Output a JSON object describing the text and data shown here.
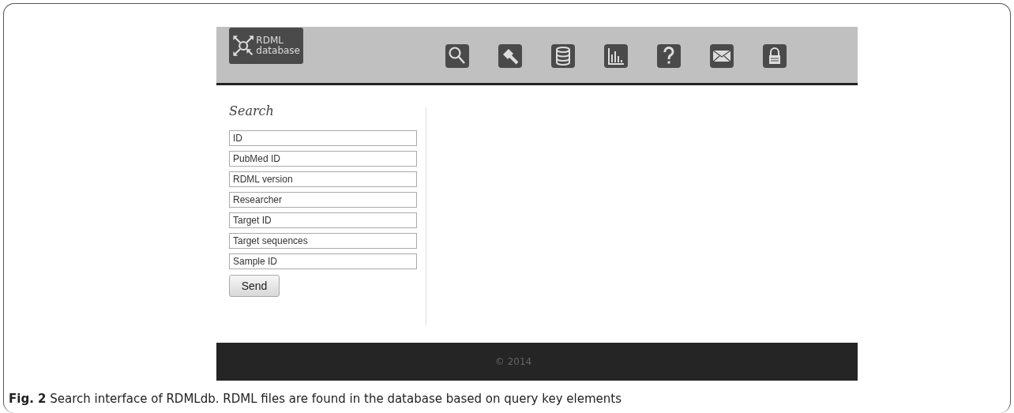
{
  "logo": {
    "line_1": "RDML",
    "line_2": "database"
  },
  "search": {
    "title": "Search",
    "fields": [
      {
        "placeholder": "ID"
      },
      {
        "placeholder": "PubMed ID"
      },
      {
        "placeholder": "RDML version"
      },
      {
        "placeholder": "Researcher"
      },
      {
        "placeholder": "Target ID"
      },
      {
        "placeholder": "Target sequences"
      },
      {
        "placeholder": "Sample ID"
      }
    ],
    "button": "Send"
  },
  "footer": "© 2014",
  "caption": "**Fig. 2** Search interface of RDMLdb. RDML files are found in the database based on query key elements"
}
